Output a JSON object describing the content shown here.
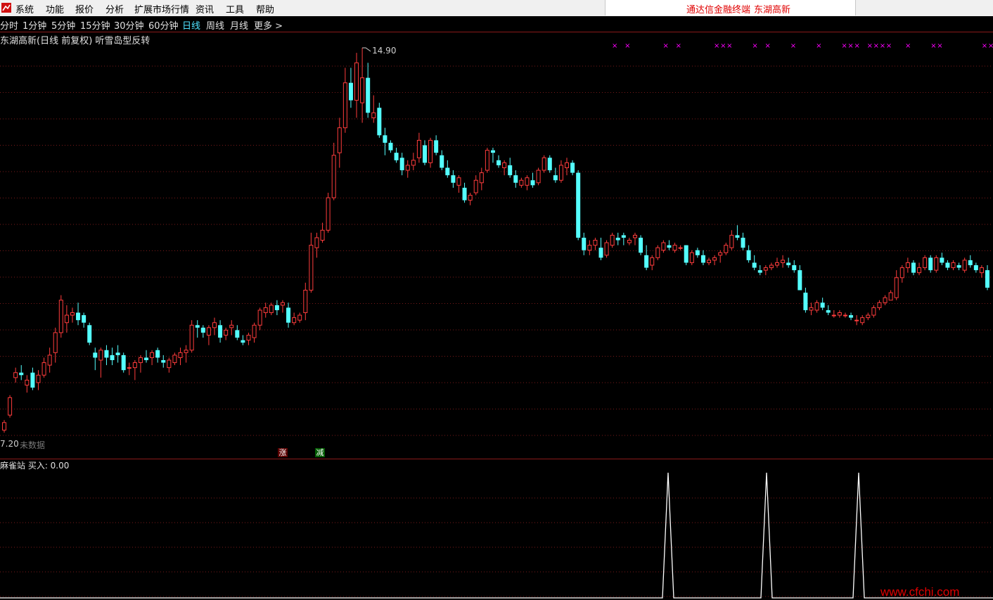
{
  "menubar": {
    "items": [
      "系统",
      "功能",
      "报价",
      "分析",
      "扩展市场行情",
      "资讯",
      "工具",
      "帮助"
    ],
    "terminal_name": "通达信金融终端",
    "stock_name": "东湖高新"
  },
  "periods": [
    "分时",
    "1分钟",
    "5分钟",
    "15分钟",
    "30分钟",
    "60分钟",
    "日线",
    "周线",
    "月线",
    "更多 >"
  ],
  "active_period": "日线",
  "chart": {
    "title": "东湖高新(日线 前复权) 听雪岛型反转",
    "high_label": "14.90",
    "low_label": "7.20",
    "no_data_text": "未数据",
    "up_tag": "涨",
    "down_tag": "减",
    "up_color": "#ff3c3c",
    "down_color": "#54ffff",
    "marker_color": "#ff00ff",
    "grid_color": "#7a1a1a"
  },
  "indicator": {
    "title": "麻雀站 买入: 0.00",
    "line_color": "#ffffff"
  },
  "chart_data": {
    "type": "candlestick",
    "price_range": [
      7.2,
      14.9
    ],
    "candles": [
      [
        7.25,
        7.45,
        7.2,
        7.4
      ],
      [
        7.55,
        7.95,
        7.5,
        7.9
      ],
      [
        8.3,
        8.5,
        8.2,
        8.4
      ],
      [
        8.4,
        8.55,
        8.25,
        8.35
      ],
      [
        8.15,
        8.35,
        8.0,
        8.25
      ],
      [
        8.4,
        8.5,
        8.05,
        8.1
      ],
      [
        8.2,
        8.45,
        8.05,
        8.35
      ],
      [
        8.35,
        8.7,
        8.3,
        8.6
      ],
      [
        8.55,
        8.9,
        8.4,
        8.75
      ],
      [
        8.8,
        9.3,
        8.6,
        9.2
      ],
      [
        9.2,
        9.95,
        9.1,
        9.85
      ],
      [
        9.4,
        9.75,
        9.2,
        9.55
      ],
      [
        9.55,
        9.7,
        9.4,
        9.6
      ],
      [
        9.6,
        9.8,
        9.35,
        9.45
      ],
      [
        9.55,
        9.6,
        9.3,
        9.4
      ],
      [
        9.35,
        9.4,
        8.95,
        9.0
      ],
      [
        8.8,
        8.9,
        8.45,
        8.7
      ],
      [
        8.65,
        8.9,
        8.3,
        8.85
      ],
      [
        8.85,
        8.95,
        8.55,
        8.7
      ],
      [
        8.75,
        8.9,
        8.55,
        8.65
      ],
      [
        8.8,
        8.95,
        8.6,
        8.75
      ],
      [
        8.75,
        8.8,
        8.4,
        8.45
      ],
      [
        8.5,
        8.6,
        8.35,
        8.5
      ],
      [
        8.5,
        8.65,
        8.25,
        8.6
      ],
      [
        8.6,
        8.75,
        8.4,
        8.7
      ],
      [
        8.7,
        8.85,
        8.6,
        8.65
      ],
      [
        8.7,
        8.85,
        8.55,
        8.8
      ],
      [
        8.85,
        8.9,
        8.6,
        8.7
      ],
      [
        8.65,
        8.75,
        8.5,
        8.6
      ],
      [
        8.5,
        8.7,
        8.4,
        8.65
      ],
      [
        8.6,
        8.8,
        8.55,
        8.75
      ],
      [
        8.7,
        8.9,
        8.55,
        8.8
      ],
      [
        8.8,
        8.95,
        8.6,
        8.85
      ],
      [
        8.85,
        9.45,
        8.8,
        9.35
      ],
      [
        9.35,
        9.45,
        9.1,
        9.3
      ],
      [
        9.3,
        9.35,
        9.1,
        9.2
      ],
      [
        9.15,
        9.35,
        8.95,
        9.3
      ],
      [
        9.3,
        9.5,
        9.15,
        9.4
      ],
      [
        9.35,
        9.45,
        9.0,
        9.1
      ],
      [
        9.15,
        9.3,
        9.05,
        9.25
      ],
      [
        9.3,
        9.45,
        9.15,
        9.35
      ],
      [
        9.25,
        9.35,
        9.05,
        9.1
      ],
      [
        9.05,
        9.15,
        8.95,
        9.0
      ],
      [
        9.05,
        9.2,
        8.95,
        9.15
      ],
      [
        9.1,
        9.4,
        9.0,
        9.35
      ],
      [
        9.35,
        9.7,
        9.25,
        9.65
      ],
      [
        9.6,
        9.8,
        9.5,
        9.7
      ],
      [
        9.6,
        9.8,
        9.55,
        9.75
      ],
      [
        9.75,
        9.85,
        9.55,
        9.65
      ],
      [
        9.75,
        9.85,
        9.6,
        9.8
      ],
      [
        9.7,
        9.8,
        9.3,
        9.4
      ],
      [
        9.4,
        9.6,
        9.35,
        9.5
      ],
      [
        9.45,
        9.6,
        9.4,
        9.55
      ],
      [
        9.6,
        10.2,
        9.45,
        10.05
      ],
      [
        10.05,
        11.2,
        10.0,
        10.95
      ],
      [
        10.9,
        11.2,
        10.7,
        11.1
      ],
      [
        11.05,
        11.4,
        11.0,
        11.25
      ],
      [
        11.25,
        12.0,
        11.2,
        11.9
      ],
      [
        11.9,
        13.0,
        11.85,
        12.75
      ],
      [
        12.8,
        13.5,
        12.5,
        13.3
      ],
      [
        13.3,
        14.5,
        13.2,
        14.2
      ],
      [
        14.2,
        14.5,
        13.7,
        13.85
      ],
      [
        13.85,
        14.8,
        13.5,
        14.6
      ],
      [
        13.8,
        14.9,
        13.4,
        14.3
      ],
      [
        14.3,
        14.6,
        13.5,
        13.6
      ],
      [
        13.5,
        13.95,
        13.4,
        13.6
      ],
      [
        13.7,
        13.8,
        13.1,
        13.15
      ],
      [
        13.15,
        13.3,
        12.75,
        13.0
      ],
      [
        13.0,
        13.05,
        12.8,
        12.85
      ],
      [
        12.8,
        12.9,
        12.6,
        12.65
      ],
      [
        12.7,
        12.8,
        12.35,
        12.45
      ],
      [
        12.45,
        12.65,
        12.3,
        12.55
      ],
      [
        12.55,
        12.8,
        12.45,
        12.65
      ],
      [
        12.7,
        13.2,
        12.6,
        13.05
      ],
      [
        12.95,
        13.05,
        12.55,
        12.6
      ],
      [
        12.6,
        13.1,
        12.5,
        13.05
      ],
      [
        13.05,
        13.15,
        12.75,
        12.8
      ],
      [
        12.75,
        12.85,
        12.45,
        12.5
      ],
      [
        12.5,
        12.65,
        12.3,
        12.35
      ],
      [
        12.35,
        12.45,
        12.1,
        12.2
      ],
      [
        12.15,
        12.35,
        12.0,
        12.3
      ],
      [
        12.1,
        12.2,
        11.8,
        11.85
      ],
      [
        11.85,
        12.0,
        11.75,
        11.95
      ],
      [
        12.0,
        12.35,
        11.95,
        12.25
      ],
      [
        12.2,
        12.5,
        12.05,
        12.4
      ],
      [
        12.45,
        12.9,
        12.4,
        12.85
      ],
      [
        12.85,
        12.9,
        12.6,
        12.8
      ],
      [
        12.65,
        12.75,
        12.5,
        12.55
      ],
      [
        12.5,
        12.65,
        12.35,
        12.6
      ],
      [
        12.55,
        12.7,
        12.3,
        12.35
      ],
      [
        12.35,
        12.45,
        12.1,
        12.2
      ],
      [
        12.15,
        12.3,
        12.1,
        12.25
      ],
      [
        12.15,
        12.35,
        12.05,
        12.3
      ],
      [
        12.25,
        12.4,
        12.1,
        12.15
      ],
      [
        12.2,
        12.5,
        12.15,
        12.45
      ],
      [
        12.45,
        12.75,
        12.4,
        12.7
      ],
      [
        12.7,
        12.75,
        12.4,
        12.45
      ],
      [
        12.35,
        12.5,
        12.2,
        12.25
      ],
      [
        12.25,
        12.65,
        12.2,
        12.55
      ],
      [
        12.5,
        12.7,
        12.35,
        12.6
      ],
      [
        12.6,
        12.65,
        12.35,
        12.4
      ],
      [
        12.4,
        12.45,
        11.05,
        11.1
      ],
      [
        11.1,
        11.2,
        10.75,
        10.85
      ],
      [
        10.85,
        11.05,
        10.75,
        10.95
      ],
      [
        10.95,
        11.1,
        10.85,
        11.05
      ],
      [
        10.9,
        11.1,
        10.65,
        10.7
      ],
      [
        10.75,
        11.05,
        10.7,
        11.0
      ],
      [
        10.95,
        11.2,
        10.9,
        11.15
      ],
      [
        11.1,
        11.2,
        10.95,
        11.05
      ],
      [
        11.15,
        11.2,
        10.95,
        11.1
      ],
      [
        11.0,
        11.1,
        10.95,
        11.05
      ],
      [
        11.1,
        11.2,
        10.95,
        11.15
      ],
      [
        11.1,
        11.15,
        10.75,
        10.8
      ],
      [
        10.75,
        10.95,
        10.45,
        10.5
      ],
      [
        10.55,
        10.75,
        10.45,
        10.7
      ],
      [
        10.7,
        10.95,
        10.65,
        10.9
      ],
      [
        10.85,
        11.05,
        10.8,
        11.0
      ],
      [
        10.95,
        11.05,
        10.85,
        10.9
      ],
      [
        10.85,
        11.0,
        10.8,
        10.95
      ],
      [
        10.9,
        10.95,
        10.85,
        10.9
      ],
      [
        10.95,
        10.95,
        10.55,
        10.6
      ],
      [
        10.6,
        10.85,
        10.55,
        10.8
      ],
      [
        10.85,
        10.9,
        10.7,
        10.75
      ],
      [
        10.75,
        10.85,
        10.55,
        10.6
      ],
      [
        10.6,
        10.7,
        10.55,
        10.65
      ],
      [
        10.65,
        10.75,
        10.55,
        10.7
      ],
      [
        10.75,
        10.85,
        10.6,
        10.8
      ],
      [
        10.8,
        11.0,
        10.75,
        10.95
      ],
      [
        10.9,
        11.25,
        10.85,
        11.15
      ],
      [
        11.15,
        11.35,
        11.05,
        11.1
      ],
      [
        11.1,
        11.2,
        10.85,
        10.9
      ],
      [
        10.85,
        10.95,
        10.6,
        10.65
      ],
      [
        10.6,
        10.75,
        10.45,
        10.5
      ],
      [
        10.45,
        10.55,
        10.35,
        10.4
      ],
      [
        10.45,
        10.55,
        10.35,
        10.5
      ],
      [
        10.5,
        10.6,
        10.45,
        10.55
      ],
      [
        10.55,
        10.7,
        10.5,
        10.6
      ],
      [
        10.6,
        10.75,
        10.5,
        10.65
      ],
      [
        10.6,
        10.7,
        10.5,
        10.55
      ],
      [
        10.55,
        10.65,
        10.4,
        10.45
      ],
      [
        10.45,
        10.55,
        10.05,
        10.05
      ],
      [
        10.0,
        10.1,
        9.6,
        9.65
      ],
      [
        9.65,
        9.8,
        9.55,
        9.7
      ],
      [
        9.65,
        9.85,
        9.6,
        9.8
      ],
      [
        9.8,
        9.9,
        9.65,
        9.7
      ],
      [
        9.65,
        9.75,
        9.55,
        9.6
      ],
      [
        9.55,
        9.65,
        9.5,
        9.55
      ],
      [
        9.55,
        9.65,
        9.5,
        9.6
      ],
      [
        9.55,
        9.6,
        9.5,
        9.55
      ],
      [
        9.55,
        9.6,
        9.45,
        9.5
      ],
      [
        9.45,
        9.55,
        9.35,
        9.45
      ],
      [
        9.4,
        9.55,
        9.35,
        9.5
      ],
      [
        9.5,
        9.6,
        9.45,
        9.55
      ],
      [
        9.55,
        9.75,
        9.5,
        9.7
      ],
      [
        9.7,
        9.85,
        9.65,
        9.8
      ],
      [
        9.8,
        9.95,
        9.75,
        9.9
      ],
      [
        9.85,
        10.05,
        9.85,
        10.0
      ],
      [
        9.9,
        10.45,
        9.85,
        10.3
      ],
      [
        10.3,
        10.55,
        10.2,
        10.5
      ],
      [
        10.5,
        10.7,
        10.4,
        10.6
      ],
      [
        10.6,
        10.65,
        10.35,
        10.4
      ],
      [
        10.4,
        10.6,
        10.35,
        10.5
      ],
      [
        10.5,
        10.75,
        10.45,
        10.7
      ],
      [
        10.7,
        10.75,
        10.4,
        10.45
      ],
      [
        10.45,
        10.75,
        10.4,
        10.7
      ],
      [
        10.7,
        10.8,
        10.55,
        10.6
      ],
      [
        10.6,
        10.65,
        10.45,
        10.5
      ],
      [
        10.5,
        10.65,
        10.45,
        10.6
      ],
      [
        10.55,
        10.6,
        10.45,
        10.5
      ],
      [
        10.45,
        10.7,
        10.4,
        10.65
      ],
      [
        10.65,
        10.75,
        10.5,
        10.55
      ],
      [
        10.55,
        10.6,
        10.4,
        10.45
      ],
      [
        10.4,
        10.55,
        10.3,
        10.5
      ],
      [
        10.45,
        10.55,
        10.05,
        10.1
      ]
    ],
    "markers_above": [
      "×",
      "×",
      "×",
      "×",
      "×××",
      "×",
      "×",
      "×",
      "×",
      "×",
      "×××",
      "××××",
      "×",
      "××",
      "××",
      "××"
    ],
    "indicator_signals": [
      0,
      0,
      0,
      1,
      0,
      1,
      0,
      1,
      0
    ]
  }
}
